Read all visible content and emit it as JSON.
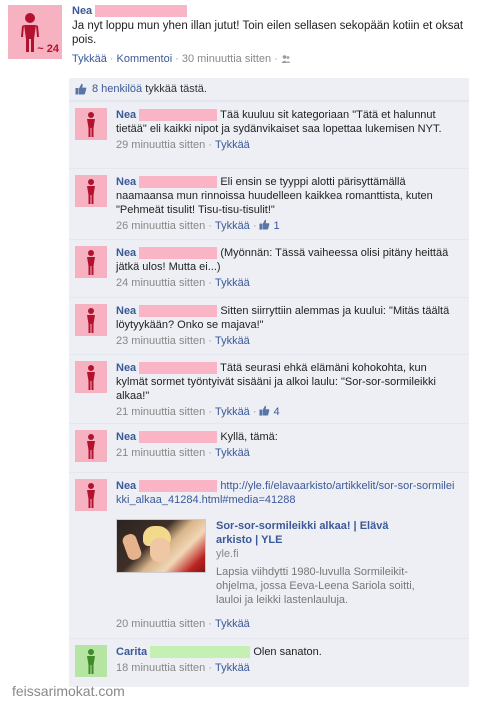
{
  "post": {
    "author": "Nea",
    "age_badge": "~ 24",
    "text": "Ja nyt loppu mun yhen illan jutut! Toin eilen sellasen sekopään kotiin et oksat pois.",
    "like_label": "Tykkää",
    "comment_label": "Kommentoi",
    "time": "30 minuuttia sitten",
    "privacy_icon": "people-icon"
  },
  "likes": {
    "text": "8 henkilöä",
    "suffix": "tykkää tästä."
  },
  "comments": [
    {
      "author": "Nea",
      "text": "Tää kuuluu sit kategoriaan \"Tätä et halunnut tietää\" eli kaikki nipot ja sydänvikaiset saa lopettaa lukemisen NYT.",
      "time": "29 minuuttia sitten",
      "like_label": "Tykkää",
      "likes": ""
    },
    {
      "author": "Nea",
      "text": "Eli ensin se tyyppi alotti pärisyttämällä naamaansa mun rinnoissa huudelleen kaikkea romanttista, kuten \"Pehmeät tisulit! Tisu-tisu-tisulit!\"",
      "time": "26 minuuttia sitten",
      "like_label": "Tykkää",
      "likes": "1"
    },
    {
      "author": "Nea",
      "text": "(Myönnän: Tässä vaiheessa olisi pitäny heittää jätkä ulos! Mutta ei...)",
      "time": "24 minuuttia sitten",
      "like_label": "Tykkää",
      "likes": ""
    },
    {
      "author": "Nea",
      "text": "Sitten siirryttiin alemmas ja kuului: \"Mitäs täältä löytyykään? Onko se majava!\"",
      "time": "23 minuuttia sitten",
      "like_label": "Tykkää",
      "likes": ""
    },
    {
      "author": "Nea",
      "text": "Tätä seurasi ehkä elämäni kohokohta, kun kylmät sormet työntyivät sisääni ja alkoi laulu: \"Sor-sor-sormileikki alkaa!\"",
      "time": "21 minuuttia sitten",
      "like_label": "Tykkää",
      "likes": "4"
    },
    {
      "author": "Nea",
      "text": "Kyllä, tämä:",
      "time": "21 minuuttia sitten",
      "like_label": "Tykkää",
      "likes": ""
    }
  ],
  "link_comment": {
    "author": "Nea",
    "url": "http://yle.fi/elavaarkisto/artikkelit/sor-sor-sormileikki_alkaa_41284.html#media=41288",
    "preview_title": "Sor-sor-sormileikki alkaa! | Elävä arkisto | YLE",
    "preview_domain": "yle.fi",
    "preview_desc": "Lapsia viihdytti 1980-luvulla Sormileikit-ohjelma, jossa Eeva-Leena Sariola soitti, lauloi ja leikki lastenlauluja.",
    "time": "20 minuuttia sitten",
    "like_label": "Tykkää"
  },
  "last_comment": {
    "author": "Carita",
    "text": "Olen sanaton.",
    "time": "18 minuuttia sitten",
    "like_label": "Tykkää"
  },
  "watermark": "feissarimokat.com",
  "colors": {
    "link": "#3b5998",
    "female_avatar": "#f7b2c2",
    "male_avatar": "#b6e5a3",
    "feed_bg": "#edeff4"
  }
}
